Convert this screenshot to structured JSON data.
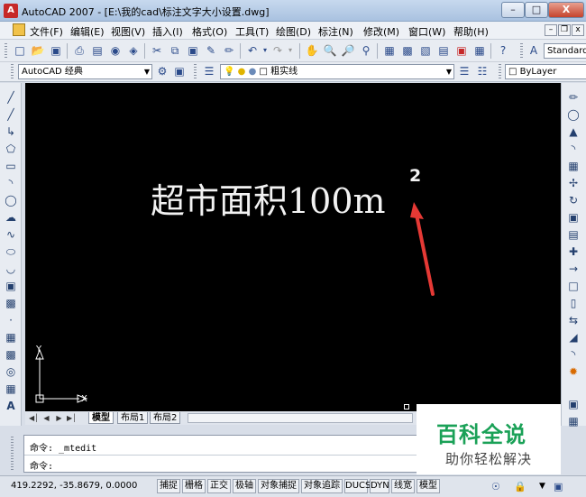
{
  "window": {
    "title": "AutoCAD 2007 - [E:\\我的cad\\标注文字大小设置.dwg]",
    "minimize": "–",
    "maximize": "□",
    "close": "X"
  },
  "menubar": {
    "items": [
      "文件(F)",
      "编辑(E)",
      "视图(V)",
      "插入(I)",
      "格式(O)",
      "工具(T)",
      "绘图(D)",
      "标注(N)",
      "修改(M)",
      "窗口(W)",
      "帮助(H)"
    ],
    "mdi_buttons": [
      "–",
      "❐",
      "x"
    ]
  },
  "toolbar1": {
    "text_style_combo": "Standard"
  },
  "toolbar2": {
    "workspace_combo": "AutoCAD 经典",
    "layer_name": "粗实线",
    "color_combo": "ByLayer"
  },
  "canvas": {
    "text": "超市面积100m",
    "superscript": "2",
    "ucs_x": "X",
    "ucs_y": "Y",
    "accent_color": "#e53935"
  },
  "tabs": {
    "items": [
      "模型",
      "布局1",
      "布局2"
    ]
  },
  "command": {
    "line1": "命令: _mtedit",
    "line2": "命令:"
  },
  "status": {
    "coords": "419.2292, -35.8679, 0.0000",
    "buttons": [
      "捕捉",
      "栅格",
      "正交",
      "极轴",
      "对象捕捉",
      "对象追踪",
      "DUCS",
      "DYN",
      "线宽",
      "模型"
    ]
  },
  "watermark": {
    "title": "百科全说",
    "subtitle": "助你轻松解决",
    "color": "#1aa157"
  }
}
